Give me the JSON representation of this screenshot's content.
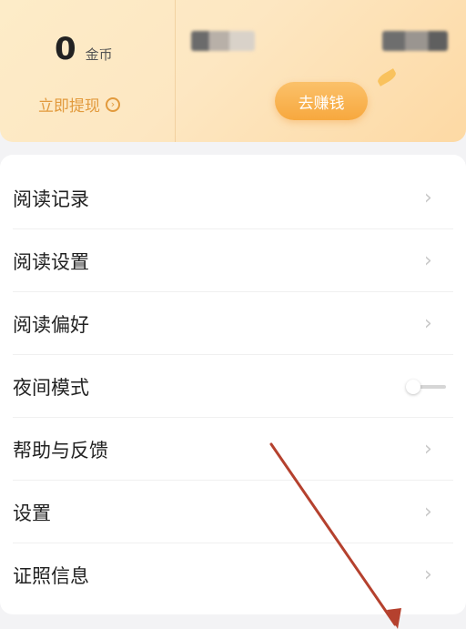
{
  "wallet": {
    "coin_value": "0",
    "coin_unit": "金币",
    "withdraw_label": "立即提现",
    "earn_button": "去赚钱"
  },
  "menu": [
    {
      "label": "阅读记录",
      "type": "link"
    },
    {
      "label": "阅读设置",
      "type": "link"
    },
    {
      "label": "阅读偏好",
      "type": "link"
    },
    {
      "label": "夜间模式",
      "type": "toggle",
      "enabled": false
    },
    {
      "label": "帮助与反馈",
      "type": "link"
    },
    {
      "label": "设置",
      "type": "link"
    },
    {
      "label": "证照信息",
      "type": "link"
    }
  ],
  "icons": {
    "chevron": "chevron-right-icon",
    "withdraw": "arrow-right-circle-icon",
    "decoration": "leaf-icon"
  },
  "colors": {
    "accent": "#f7a83e",
    "withdraw_text": "#e29a3d",
    "annotation_arrow": "#b5412e"
  }
}
